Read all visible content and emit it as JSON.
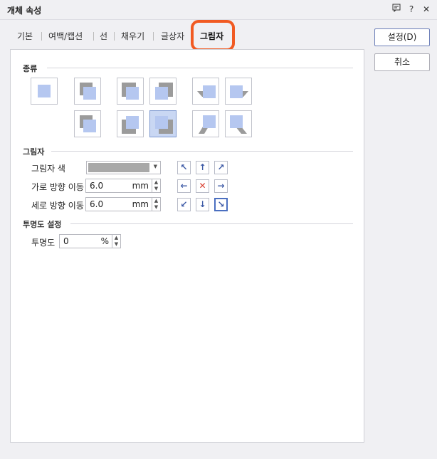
{
  "window": {
    "title": "개체 속성",
    "controls": [
      "comment-icon",
      "help-icon",
      "close-icon"
    ],
    "help_label": "?",
    "close_label": "✕"
  },
  "tabs": [
    {
      "label": "기본"
    },
    {
      "label": "여백/캡션"
    },
    {
      "label": "선"
    },
    {
      "label": "채우기"
    },
    {
      "label": "글상자"
    },
    {
      "label": "그림자",
      "active": true
    }
  ],
  "buttons": {
    "ok": "설정(D)",
    "cancel": "취소"
  },
  "sections": {
    "type": "종류",
    "shadow": "그림자",
    "transparency": "투명도 설정"
  },
  "shadow": {
    "color_label": "그림자 색",
    "color_value": "#a8a8a8",
    "horizontal_label": "가로 방향 이동",
    "horizontal_value": "6.0",
    "vertical_label": "세로 방향 이동",
    "vertical_value": "6.0",
    "unit": "mm",
    "selected_type": "bottom-right-offset",
    "selected_direction": "down-right"
  },
  "transparency": {
    "label": "투명도",
    "value": "0",
    "unit": "%"
  },
  "colors": {
    "accent": "#f15a22",
    "shape": "#b5c7f0",
    "shadow": "#9b9b9b",
    "selected": "#c9d7f3"
  }
}
